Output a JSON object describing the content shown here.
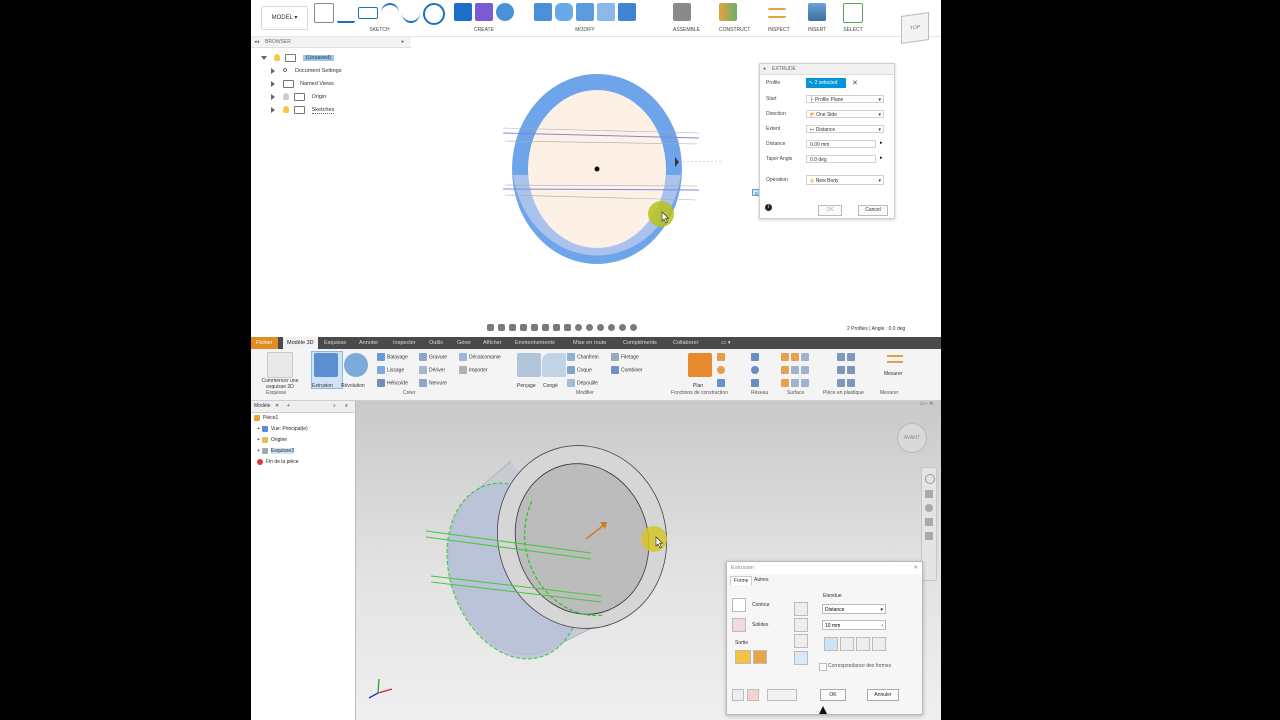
{
  "fusion": {
    "workspace": "MODEL",
    "toolbar_groups": [
      "SKETCH",
      "CREATE",
      "MODIFY",
      "ASSEMBLE",
      "CONSTRUCT",
      "INSPECT",
      "INSERT",
      "SELECT"
    ],
    "viewcube_label": "TOP",
    "browser": {
      "title": "BROWSER",
      "root": "(Unsaved)",
      "items": [
        "Document Settings",
        "Named Views",
        "Origin",
        "Sketches"
      ]
    },
    "extrude": {
      "title": "EXTRUDE",
      "profile_label": "Profile",
      "profile_value": "2 selected",
      "start_label": "Start",
      "start_value": "Profile Plane",
      "direction_label": "Direction",
      "direction_value": "One Side",
      "extent_label": "Extent",
      "extent_value": "Distance",
      "distance_label": "Distance",
      "distance_value": "0.00 mm",
      "taper_label": "Taper Angle",
      "taper_value": "0.0 deg",
      "operation_label": "Operation",
      "operation_value": "New Body",
      "ok": "OK",
      "cancel": "Cancel"
    },
    "float_input": "0.00 mm",
    "status": "2 Profiles | Angle : 0.0 deg",
    "colors": {
      "accent": "#0696d7",
      "ring": "#6ea4ea",
      "profile_fill": "#fdf1e6"
    }
  },
  "inventor": {
    "menu": [
      "Fichier",
      "Modèle 3D",
      "Esquisse",
      "Annoter",
      "Inspecter",
      "Outils",
      "Gérer",
      "Afficher",
      "Environnements",
      "Mise en route",
      "Compléments",
      "Collaborer"
    ],
    "ribbon": {
      "start_sketch": "Commencer une esquisse 2D",
      "extrusion": "Extrusion",
      "revolution": "Révolution",
      "balayage": "Balayage",
      "gravure": "Gravure",
      "decalcomanie": "Décalcomanie",
      "lissage": "Lissage",
      "deriver": "Dériver",
      "importer": "Importer",
      "helicoide": "Hélicoïde",
      "nervure": "Nervure",
      "percage": "Perçage",
      "conge": "Congé",
      "chanfrein": "Chanfrein",
      "filetage": "Filetage",
      "coque": "Coque",
      "combiner": "Combiner",
      "depouille": "Dépouille",
      "plan": "Plan",
      "mesurer": "Mesurer",
      "sections": [
        "Esquisse",
        "Créer",
        "Modifier",
        "Fonctions de construction",
        "Réseau",
        "Surface",
        "Pièce en plastique",
        "Mesurer"
      ]
    },
    "browser": {
      "tab": "Modèle",
      "items": [
        "Pièce1",
        "Vue: Principal(e)",
        "Origine",
        "Esquisse3",
        "Fin de la pièce"
      ]
    },
    "viewcube_label": "AVANT",
    "dialog": {
      "title": "Extrusion",
      "tabs": [
        "Forme",
        "Autres"
      ],
      "contour": "Contour",
      "solides": "Solides",
      "sortie": "Sortie",
      "etendue": "Etendue",
      "extent_value": "Distance",
      "distance_value": "10 mm",
      "match_shape": "Correspondance des formes",
      "ok": "OK",
      "cancel": "Annuler"
    },
    "colors": {
      "file_tab": "#e08c22",
      "menu_bg": "#4a4a4a",
      "profile_green": "#45c93a",
      "direction_arrow": "#d47a1e"
    }
  }
}
